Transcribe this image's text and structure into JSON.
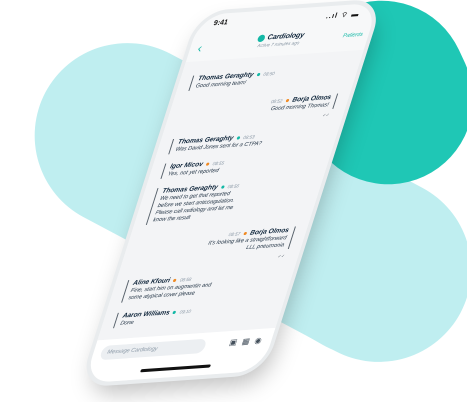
{
  "statusbar": {
    "time": "9:41",
    "icons": "..ıl ⌔ ▬"
  },
  "header": {
    "back_icon": "chevron-left-icon",
    "title": "Cardiology",
    "subtitle": "Active 7 minutes ago",
    "patients_link": "Patients",
    "brand_color": "#14b8a6"
  },
  "messages": [
    {
      "side": "left",
      "name": "Thomas Geraghty",
      "time": "08:50",
      "dot": "teal",
      "text": "Good morning team!"
    },
    {
      "side": "right",
      "name": "Borja Olmos",
      "time": "08:52",
      "dot": "orange",
      "text": "Good morning Thomas!"
    },
    {
      "side": "left",
      "name": "Thomas Geraghty",
      "time": "08:53",
      "dot": "teal",
      "text": "Was David Jones sent for a CTPA?"
    },
    {
      "side": "left",
      "name": "Igor Micov",
      "time": "08:55",
      "dot": "orange",
      "text": "Yes, not yet reported"
    },
    {
      "side": "left",
      "name": "Thomas Geraghty",
      "time": "08:56",
      "dot": "teal",
      "text_lines": [
        "We need to get that reported",
        "before we start anticoagulation.",
        "Please call radiology and let me",
        "know  the result"
      ]
    },
    {
      "side": "right",
      "name": "Borja Olmos",
      "time": "08:57",
      "dot": "orange",
      "text_lines": [
        "It's looking like a straightforward",
        "LLL pneumonia"
      ]
    },
    {
      "side": "left",
      "name": "Aline Kfouri",
      "time": "08:58",
      "dot": "orange",
      "text_lines": [
        "Fine, start him on augmentin and",
        "some atypical cover please"
      ]
    },
    {
      "side": "left",
      "name": "Aaron Williams",
      "time": "09:10",
      "dot": "teal",
      "text": "Done"
    }
  ],
  "composer": {
    "placeholder": "Message Cardiology",
    "icons": [
      "camera-icon",
      "image-icon",
      "user-icon"
    ]
  }
}
